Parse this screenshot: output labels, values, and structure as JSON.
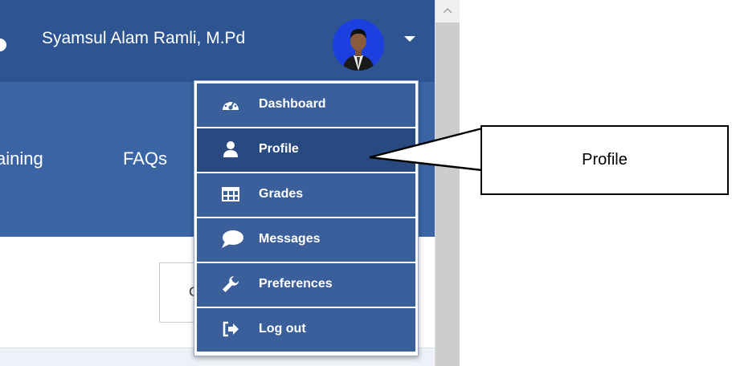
{
  "header": {
    "user_name": "Syamsul Alam Ramli, M.Pd",
    "avatar_icon": "avatar-photo",
    "menu_toggle_icon": "caret-down-icon"
  },
  "nav": {
    "items": [
      "aining",
      "FAQs"
    ]
  },
  "content": {
    "box_text": "C"
  },
  "dropdown": {
    "items": [
      {
        "label": "Dashboard",
        "icon": "tachometer-icon"
      },
      {
        "label": "Profile",
        "icon": "user-icon"
      },
      {
        "label": "Grades",
        "icon": "table-icon"
      },
      {
        "label": "Messages",
        "icon": "speech-bubble-icon"
      },
      {
        "label": "Preferences",
        "icon": "wrench-icon"
      },
      {
        "label": "Log out",
        "icon": "sign-out-icon"
      }
    ]
  },
  "callout": {
    "text": "Profile"
  },
  "colors": {
    "topbar": "#2e5592",
    "navbar": "#3b64a4",
    "menu_item": "#3a5f9b",
    "menu_item_active": "#284a80"
  }
}
